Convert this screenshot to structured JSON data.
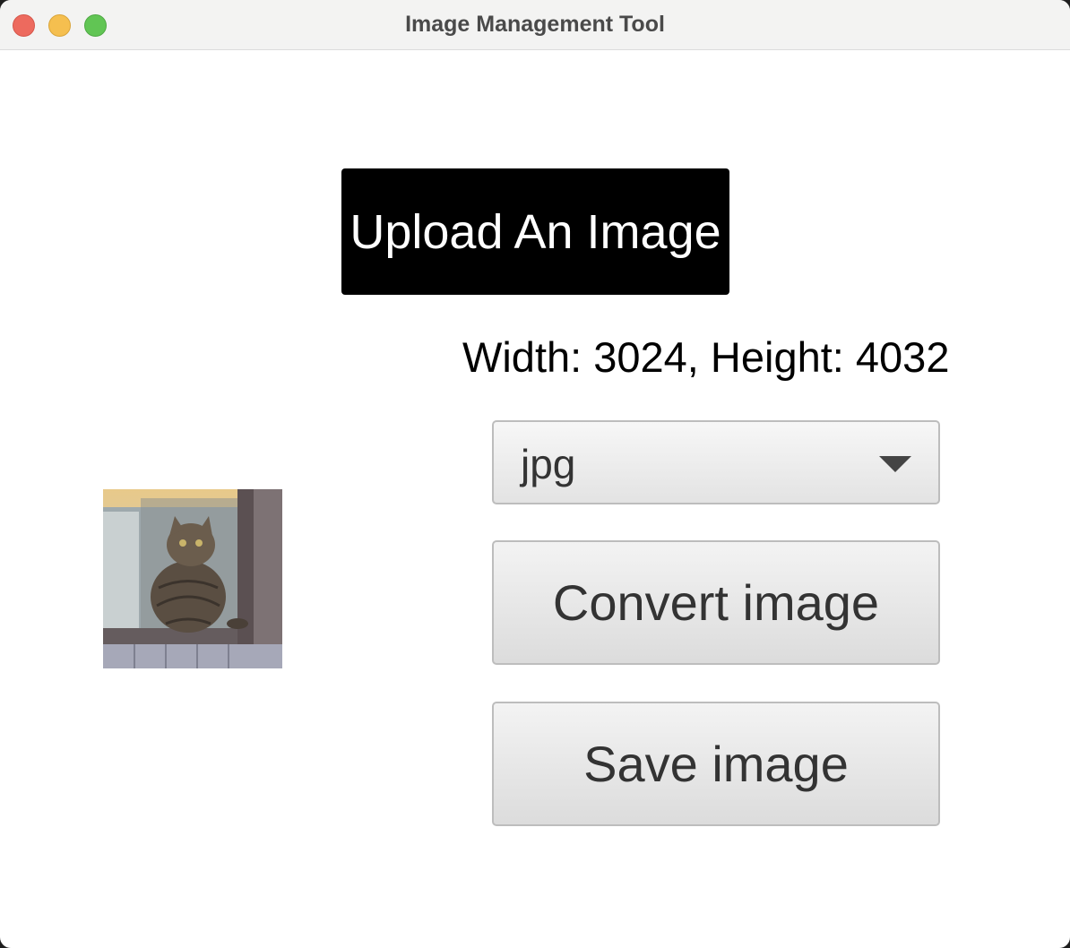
{
  "window": {
    "title": "Image Management Tool"
  },
  "main": {
    "upload_label": "Upload An Image",
    "dimensions_text": "Width: 3024, Height: 4032",
    "format_select": {
      "selected": "jpg"
    },
    "convert_label": "Convert image",
    "save_label": "Save image"
  }
}
